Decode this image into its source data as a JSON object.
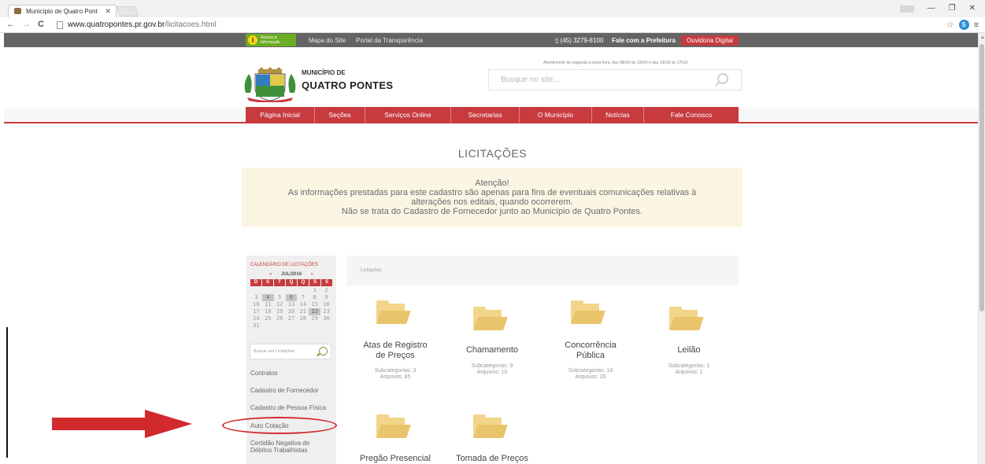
{
  "browser": {
    "tab_title": "Município de Quatro Pont",
    "url_host": "www.quatropontes.pr.gov.br",
    "url_path": "/licitacoes.html"
  },
  "topbar": {
    "acesso_line1": "Acesso à",
    "acesso_line2": "Informação",
    "mapa": "Mapa do Site",
    "portal": "Portal da Transparência",
    "phone": "(45) 3279-8100",
    "fale": "Fale com a Prefeitura",
    "ouvidoria": "Ouvidoria Digital"
  },
  "header": {
    "logo_small": "MUNICÍPIO DE",
    "logo_big": "QUATRO PONTES",
    "hours": "Atendimento de segunda à sexta-feira, das 08h00 às 12h00 e das 13h30 às 17h30",
    "search_placeholder": "Busque no site..."
  },
  "menu": [
    "Página Inicial",
    "Seções",
    "Serviços Online",
    "Secretarias",
    "O Município",
    "Notícias",
    "Fale Conosco"
  ],
  "page": {
    "title": "LICITAÇÕES",
    "notice": [
      "Atenção!",
      "As informações prestadas para este cadastro são apenas para fins de eventuais comunicações relativas à",
      "alterações nos editais, quando ocorrerem.",
      "Não se trata do Cadastro de Fornecedor junto ao Município de Quatro Pontes."
    ]
  },
  "sidebar": {
    "cal_title": "CALENDÁRIO DE LICITAÇÕES",
    "cal_prev": "«",
    "cal_month": "JUL/2016",
    "cal_next": "»",
    "weekdays": [
      "D",
      "S",
      "T",
      "Q",
      "Q",
      "S",
      "S"
    ],
    "weeks": [
      [
        "",
        "",
        "",
        "",
        "",
        "1",
        "2"
      ],
      [
        "3",
        "4",
        "5",
        "6",
        "7",
        "8",
        "9"
      ],
      [
        "10",
        "11",
        "12",
        "13",
        "14",
        "15",
        "16"
      ],
      [
        "17",
        "18",
        "19",
        "20",
        "21",
        "22",
        "23"
      ],
      [
        "24",
        "25",
        "26",
        "27",
        "28",
        "29",
        "30"
      ],
      [
        "31",
        "",
        "",
        "",
        "",
        "",
        ""
      ]
    ],
    "search_placeholder": "Buscar em Licitações",
    "links": [
      "Contratos",
      "Cadastro de Fornecedor",
      "Cadastro de Pessoa Física",
      "Auto Cotação",
      "Certidão Negativa de",
      "Débitos Trabalhistas"
    ]
  },
  "main": {
    "breadcrumb": "Licitações",
    "categories": [
      {
        "title1": "Atas de Registro",
        "title2": "de Preços",
        "sub": "Subcategorias: 3",
        "files": "Arquivos: 85"
      },
      {
        "title1": "Chamamento",
        "title2": "",
        "sub": "Subcategorias: 9",
        "files": "Arquivos: 10"
      },
      {
        "title1": "Concorrência",
        "title2": "Pública",
        "sub": "Subcategorias: 18",
        "files": "Arquivos: 26"
      },
      {
        "title1": "Leilão",
        "title2": "",
        "sub": "Subcategorias: 1",
        "files": "Arquivos: 1"
      },
      {
        "title1": "Pregão Presencial",
        "title2": "",
        "sub": "",
        "files": ""
      },
      {
        "title1": "Tomada de Preços",
        "title2": "",
        "sub": "",
        "files": ""
      }
    ]
  },
  "colors": {
    "brand_red": "#c73b3f",
    "green": "#6bad24",
    "folder": "#f2d58a",
    "annotation": "#d2292c"
  }
}
